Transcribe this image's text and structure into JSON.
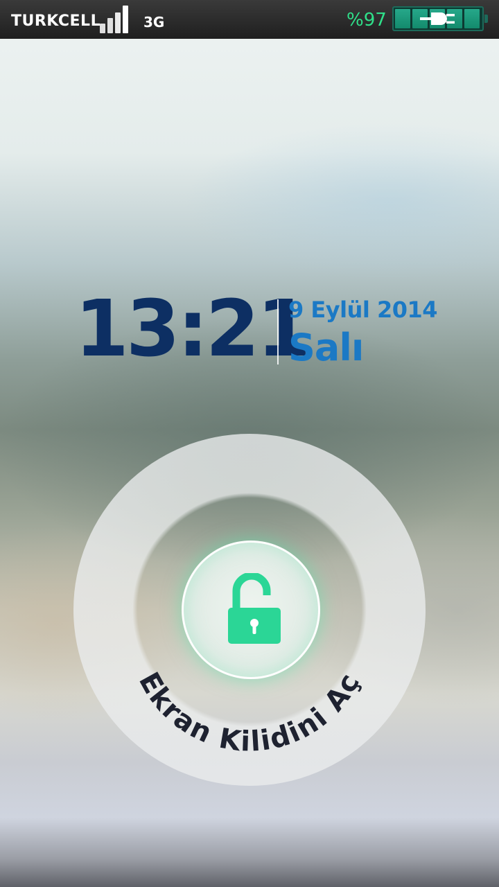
{
  "status_bar": {
    "carrier": "TURKCELL",
    "network_type": "3G",
    "signal_bars": 4,
    "battery_percent": "%97",
    "battery_charging": true,
    "signal_icon": "signal-strength-icon",
    "battery_icon": "battery-charging-icon"
  },
  "lock_screen": {
    "time": "13:21",
    "date": "9 Eylül 2014",
    "weekday": "Salı",
    "unlock_label": "Ekran Kilidini Aç",
    "unlock_icon": "unlocked-padlock-icon"
  },
  "colors": {
    "clock": "#0d2f63",
    "date": "#1b79c5",
    "accent": "#2bd696",
    "battery_text": "#2fe08a"
  }
}
